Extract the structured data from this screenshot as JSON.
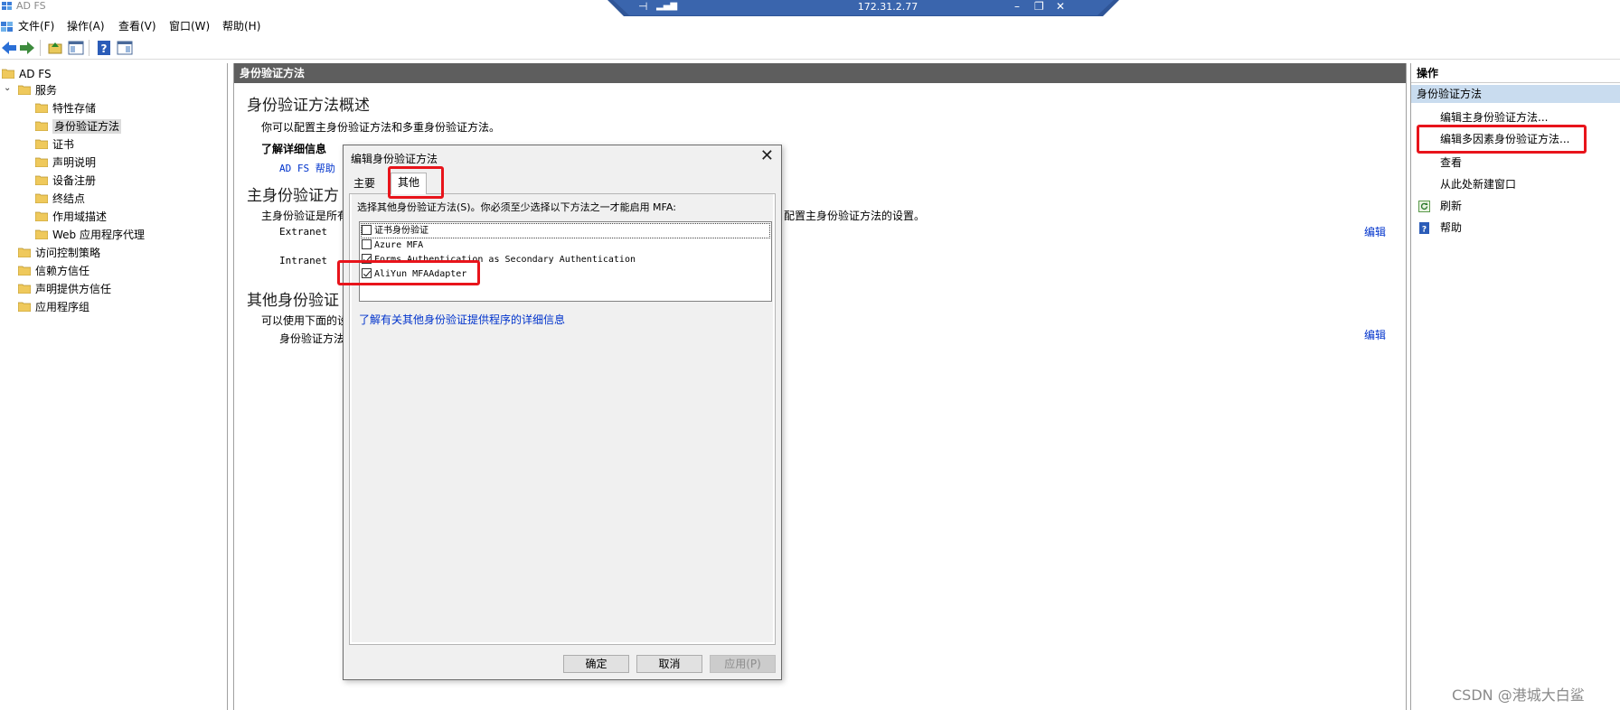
{
  "window": {
    "title": "AD FS"
  },
  "remote": {
    "host": "172.31.2.77"
  },
  "menu": [
    "文件(F)",
    "操作(A)",
    "查看(V)",
    "窗口(W)",
    "帮助(H)"
  ],
  "tree": {
    "root": "AD FS",
    "items": [
      {
        "label": "服务",
        "level": 1
      },
      {
        "label": "特性存储",
        "level": 2
      },
      {
        "label": "身份验证方法",
        "level": 2,
        "selected": true
      },
      {
        "label": "证书",
        "level": 2
      },
      {
        "label": "声明说明",
        "level": 2
      },
      {
        "label": "设备注册",
        "level": 2
      },
      {
        "label": "终结点",
        "level": 2
      },
      {
        "label": "作用域描述",
        "level": 2
      },
      {
        "label": "Web 应用程序代理",
        "level": 2
      },
      {
        "label": "访问控制策略",
        "level": 1
      },
      {
        "label": "信赖方信任",
        "level": 1
      },
      {
        "label": "声明提供方信任",
        "level": 1
      },
      {
        "label": "应用程序组",
        "level": 1
      }
    ]
  },
  "center": {
    "header": "身份验证方法",
    "overview_title": "身份验证方法概述",
    "overview_desc": "你可以配置主身份验证方法和多重身份验证方法。",
    "learn_more": "了解详细信息",
    "help_link": "AD FS 帮助",
    "primary_title": "主身份验证方",
    "primary_desc_left": "主身份验证是所有",
    "primary_desc_right": "配置主身份验证方法的设置。",
    "extranet": "Extranet",
    "intranet": "Intranet",
    "edit": "编辑",
    "other_title": "其他身份验证",
    "other_desc": "可以使用下面的设",
    "other_row": "身份验证方法"
  },
  "actions": {
    "header": "操作",
    "section": "身份验证方法",
    "items": [
      "编辑主身份验证方法...",
      "编辑多因素身份验证方法...",
      "查看",
      "从此处新建窗口",
      "刷新",
      "帮助"
    ]
  },
  "dialog": {
    "title": "编辑身份验证方法",
    "tabs": [
      "主要",
      "其他"
    ],
    "instruction": "选择其他身份验证方法(S)。你必须至少选择以下方法之一才能启用 MFA:",
    "methods": [
      {
        "label": "证书身份验证",
        "checked": false
      },
      {
        "label": "Azure MFA",
        "checked": false
      },
      {
        "label": "Forms Authentication as Secondary Authentication",
        "checked": true
      },
      {
        "label": "AliYun MFAAdapter",
        "checked": true
      }
    ],
    "more_info_link": "了解有关其他身份验证提供程序的详细信息",
    "buttons": {
      "ok": "确定",
      "cancel": "取消",
      "apply": "应用(P)"
    }
  },
  "watermark": "CSDN @港城大白鲨",
  "colors": {
    "annotation": "#e8141b",
    "link": "#0033cc",
    "pane_header": "#5e5e5e",
    "rdp_bar": "#2f5597"
  }
}
